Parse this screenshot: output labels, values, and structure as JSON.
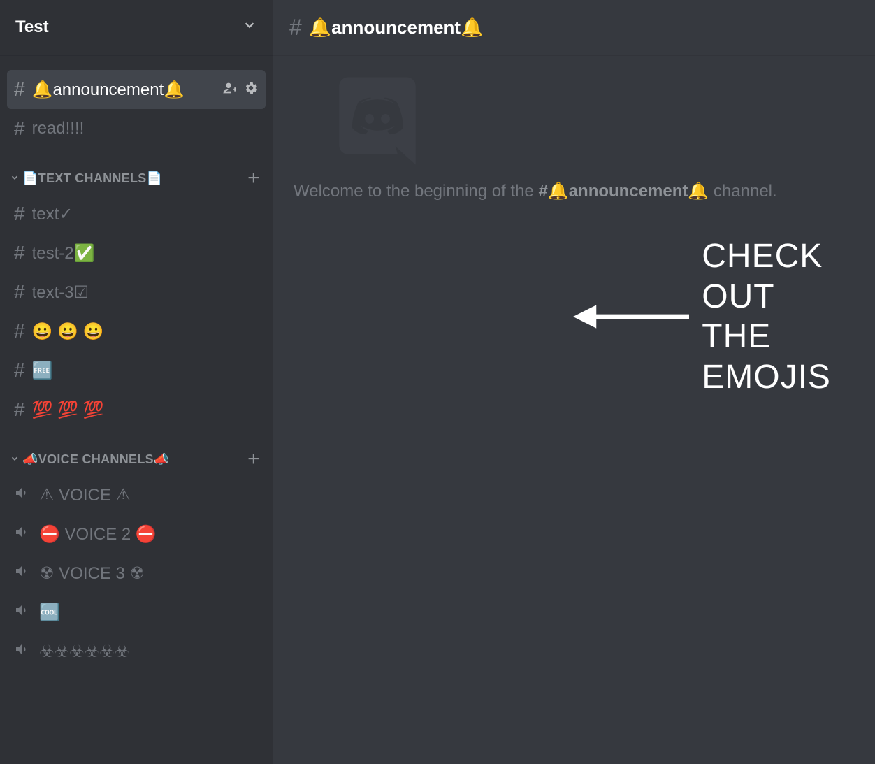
{
  "server": {
    "name": "Test"
  },
  "pinned_channels": [
    {
      "id": "announcement",
      "name": "🔔announcement🔔",
      "selected": true
    },
    {
      "id": "read",
      "name": "read!!!!",
      "selected": false
    }
  ],
  "categories": [
    {
      "id": "text-cat",
      "label": "📄TEXT CHANNELS📄",
      "type": "text",
      "channels": [
        {
          "name": "text✓"
        },
        {
          "name": "test-2✅"
        },
        {
          "name": "text-3☑"
        },
        {
          "name": "😀 😀 😀"
        },
        {
          "name": "🆓"
        },
        {
          "name": "💯 💯 💯"
        }
      ]
    },
    {
      "id": "voice-cat",
      "label": "📣VOICE CHANNELS📣",
      "type": "voice",
      "channels": [
        {
          "name": "⚠ VOICE ⚠"
        },
        {
          "name": "⛔  VOICE 2 ⛔"
        },
        {
          "name": "☢ VOICE 3 ☢"
        },
        {
          "name": "🆒"
        },
        {
          "name": "☣☣☣☣☣☣"
        }
      ]
    }
  ],
  "current_channel": {
    "name": "🔔announcement🔔",
    "welcome_prefix": "Welcome to the beginning of the ",
    "welcome_suffix": " channel."
  },
  "annotation": {
    "line1": "CHECK OUT",
    "line2": "THE EMOJIS"
  }
}
